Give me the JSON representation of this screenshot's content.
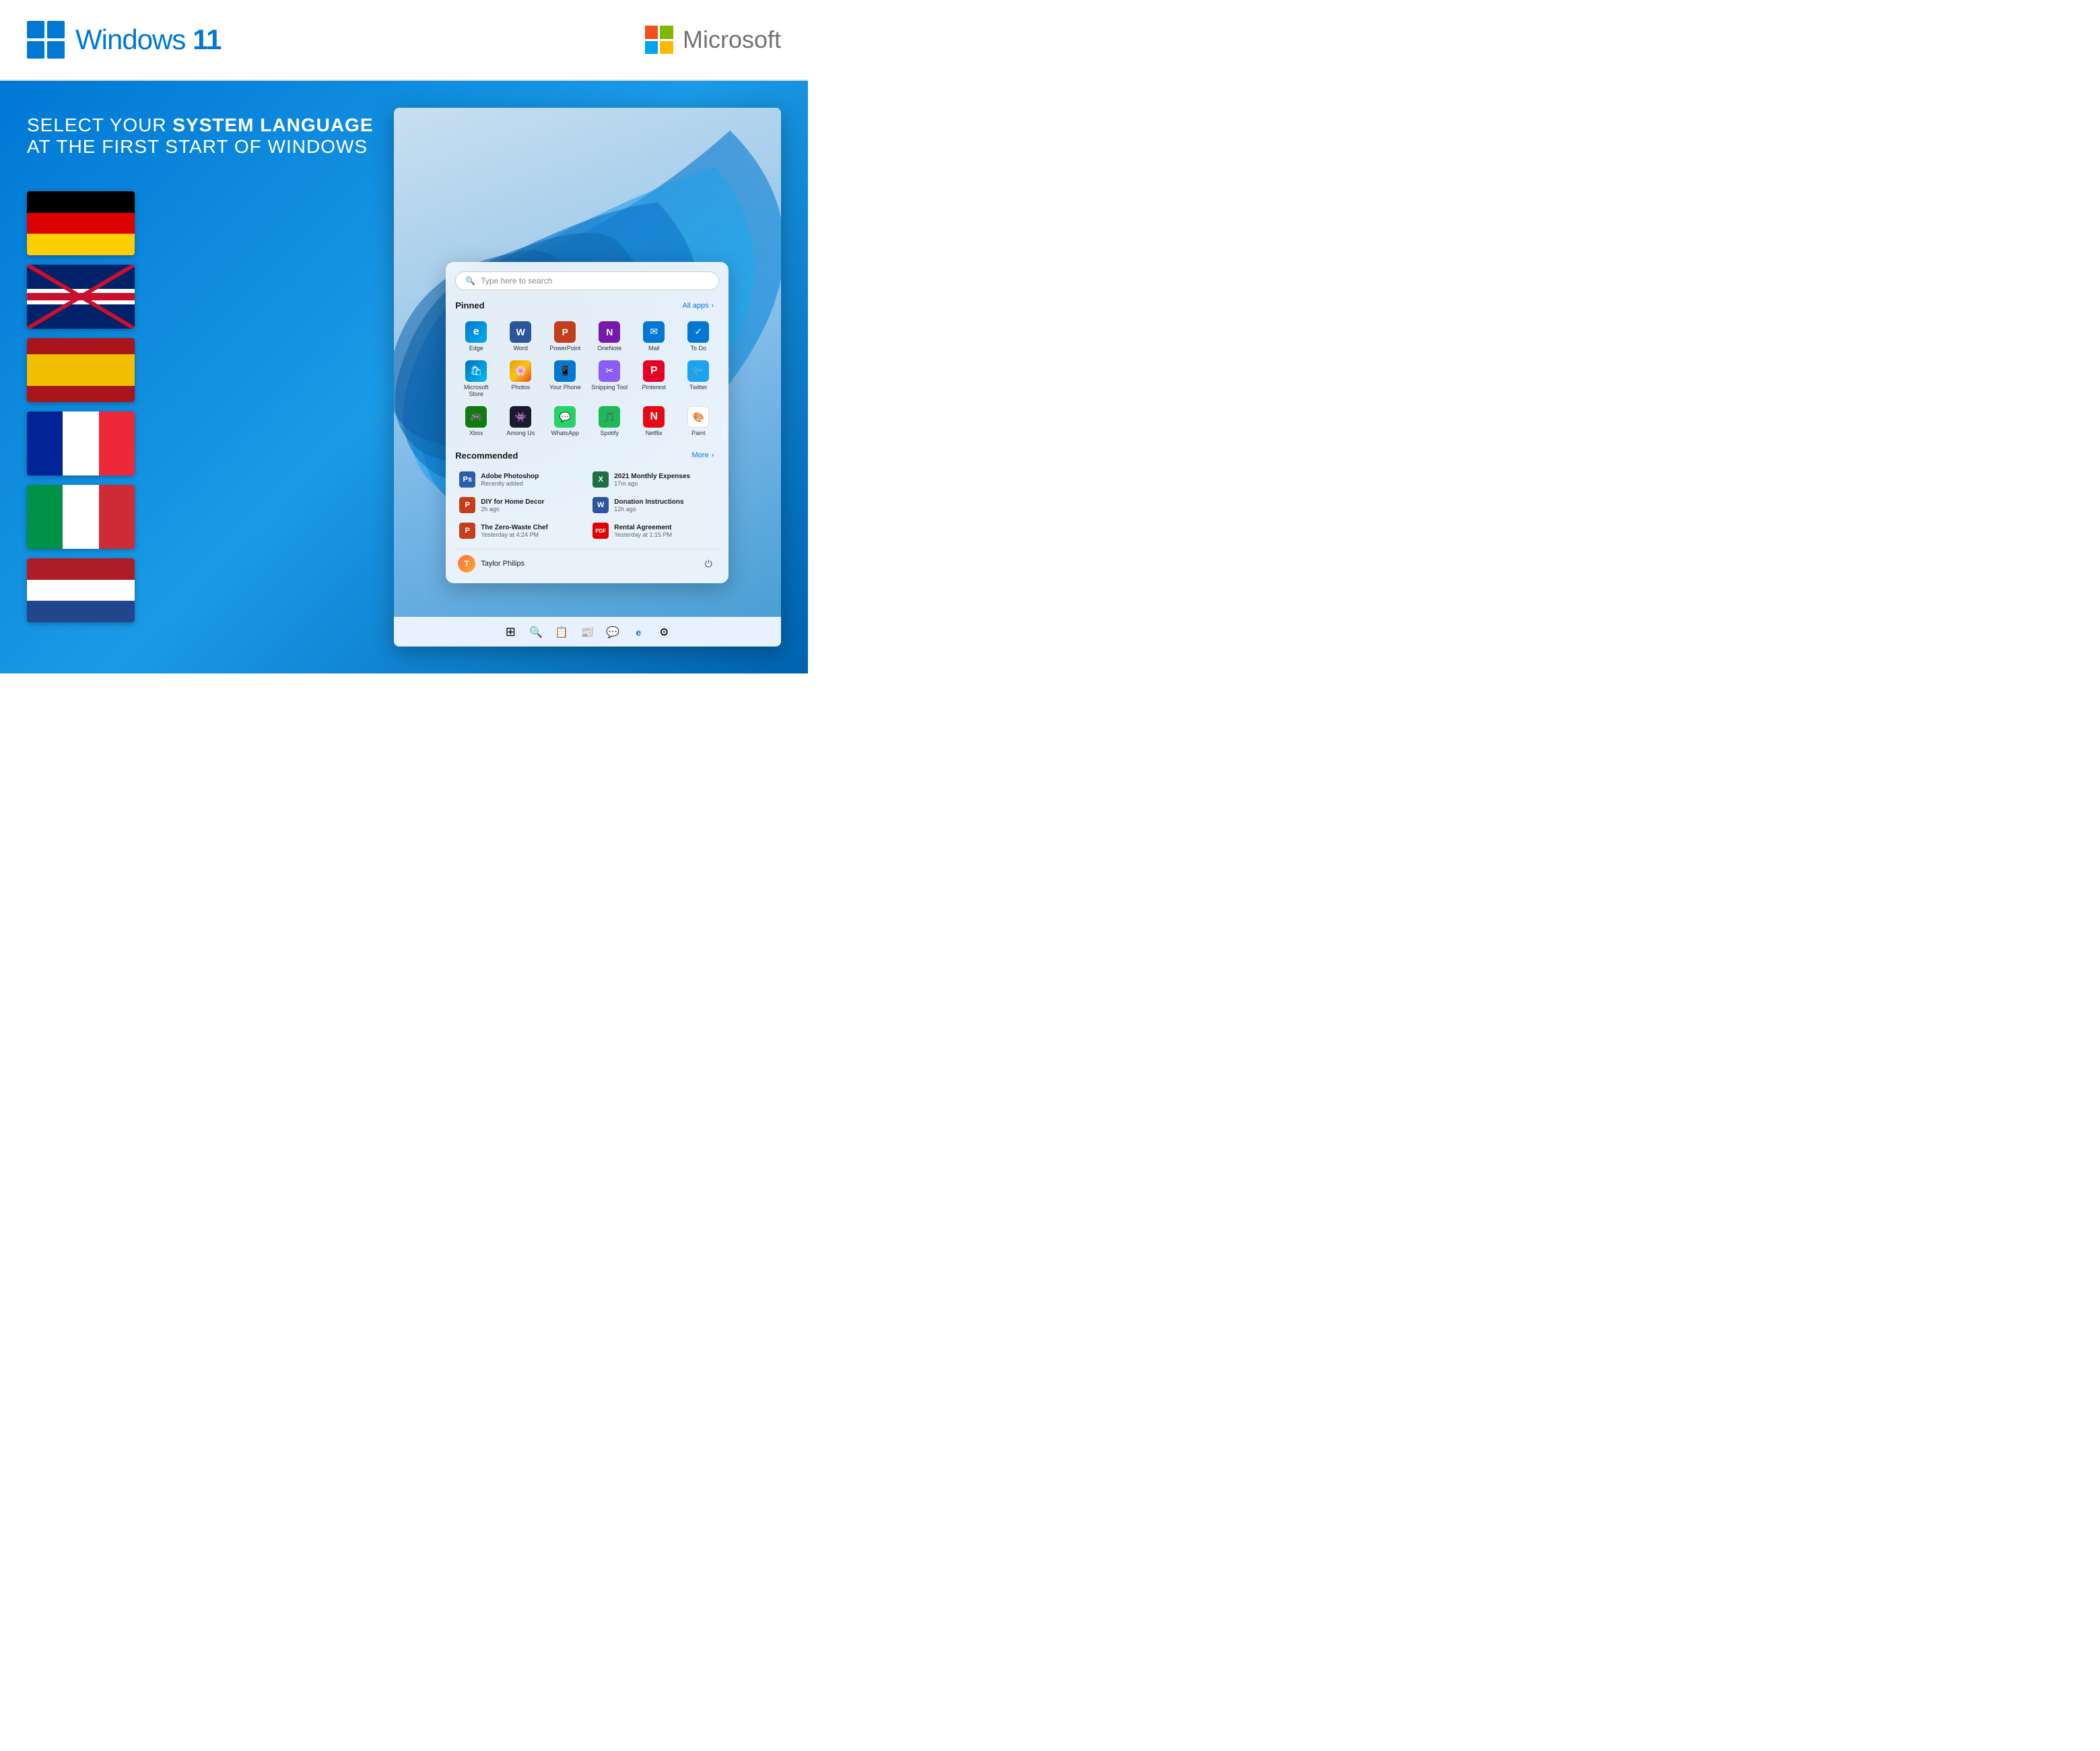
{
  "header": {
    "windows_title": "Windows 11",
    "microsoft_title": "Microsoft"
  },
  "headline": {
    "line1_normal": "SELECT YOUR ",
    "line1_bold": "SYSTEM LANGUAGE",
    "line2": "AT THE FIRST START OF WINDOWS"
  },
  "flags": [
    {
      "id": "de",
      "name": "German"
    },
    {
      "id": "uk",
      "name": "English"
    },
    {
      "id": "es",
      "name": "Spanish"
    },
    {
      "id": "fr",
      "name": "French"
    },
    {
      "id": "it",
      "name": "Italian"
    },
    {
      "id": "nl",
      "name": "Dutch"
    }
  ],
  "start_menu": {
    "search_placeholder": "Type here to search",
    "pinned_label": "Pinned",
    "all_apps_label": "All apps",
    "recommended_label": "Recommended",
    "more_label": "More",
    "pinned_apps": [
      {
        "name": "Edge",
        "icon_class": "icon-edge",
        "symbol": "🌐"
      },
      {
        "name": "Word",
        "icon_class": "icon-word",
        "symbol": "W"
      },
      {
        "name": "PowerPoint",
        "icon_class": "icon-ppt",
        "symbol": "P"
      },
      {
        "name": "OneNote",
        "icon_class": "icon-onenote",
        "symbol": "N"
      },
      {
        "name": "Mail",
        "icon_class": "icon-mail",
        "symbol": "✉"
      },
      {
        "name": "To Do",
        "icon_class": "icon-todo",
        "symbol": "✓"
      },
      {
        "name": "Microsoft Store",
        "icon_class": "icon-store",
        "symbol": "🛒"
      },
      {
        "name": "Photos",
        "icon_class": "icon-photos",
        "symbol": "🖼"
      },
      {
        "name": "Your Phone",
        "icon_class": "icon-phone",
        "symbol": "📱"
      },
      {
        "name": "Snipping Tool",
        "icon_class": "icon-snipping",
        "symbol": "✂"
      },
      {
        "name": "Pinterest",
        "icon_class": "icon-pinterest",
        "symbol": "P"
      },
      {
        "name": "Twitter",
        "icon_class": "icon-twitter",
        "symbol": "🐦"
      },
      {
        "name": "Xbox",
        "icon_class": "icon-xbox",
        "symbol": "🎮"
      },
      {
        "name": "Among Us",
        "icon_class": "icon-among",
        "symbol": "👾"
      },
      {
        "name": "WhatsApp",
        "icon_class": "icon-whatsapp",
        "symbol": "💬"
      },
      {
        "name": "Spotify",
        "icon_class": "icon-spotify",
        "symbol": "🎵"
      },
      {
        "name": "Netflix",
        "icon_class": "icon-netflix",
        "symbol": "N"
      },
      {
        "name": "Paint",
        "icon_class": "icon-paint",
        "symbol": "🎨"
      }
    ],
    "recommended_items": [
      {
        "name": "Adobe Photoshop",
        "sub": "Recently added",
        "icon_color": "#2b5cad",
        "symbol": "Ps"
      },
      {
        "name": "2021 Monthly Expenses",
        "sub": "17m ago",
        "icon_color": "#1d6f42",
        "symbol": "X"
      },
      {
        "name": "DIY for Home Decor",
        "sub": "2h ago",
        "icon_color": "#c43e1c",
        "symbol": "P"
      },
      {
        "name": "Donation Instructions",
        "sub": "12h ago",
        "icon_color": "#2b579a",
        "symbol": "W"
      },
      {
        "name": "The Zero-Waste Chef",
        "sub": "Yesterday at 4:24 PM",
        "icon_color": "#c43e1c",
        "symbol": "P"
      },
      {
        "name": "Rental Agreement",
        "sub": "Yesterday at 1:15 PM",
        "icon_color": "#e20000",
        "symbol": "PDF"
      }
    ],
    "user_name": "Taylor Philips"
  },
  "taskbar": {
    "icons": [
      "⊞",
      "🔍",
      "📁",
      "🗒",
      "💬",
      "🌐",
      "⚙"
    ]
  }
}
